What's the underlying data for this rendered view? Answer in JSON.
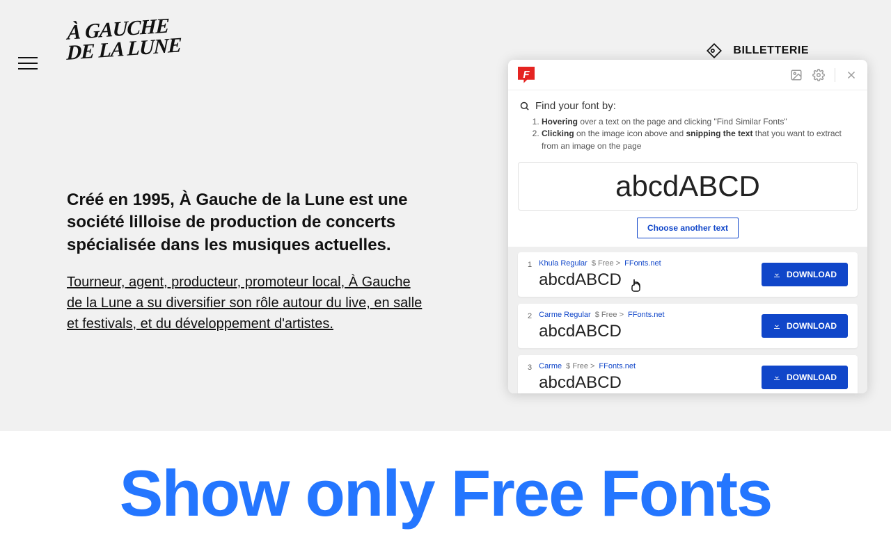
{
  "header": {
    "logo_line1": "À GAUCHE",
    "logo_line2": "DE LA LUNE",
    "billetterie": "BILLETTERIE"
  },
  "main": {
    "headline": "Créé en 1995, À Gauche de la Lune est une société lilloise de production de concerts spécialisée dans les musiques actuelles.",
    "sub": "Tourneur, agent, producteur, promoteur local, À Gauche de la Lune a su diversifier son rôle autour du live, en salle et festivals, et du développement d'artistes."
  },
  "panel": {
    "find_title": "Find your font by:",
    "inst1_pre": "Hovering",
    "inst1_post": " over a text on the page and clicking \"Find Similar Fonts\"",
    "inst2_pre": "Clicking",
    "inst2_mid": " on the image icon above and ",
    "inst2_bold": "snipping the text",
    "inst2_post": " that you want to extract from an image on the page",
    "sample": "abcdABCD",
    "choose": "Choose another text",
    "download_label": "DOWNLOAD",
    "results": [
      {
        "num": "1",
        "name": "Khula Regular",
        "price": "$ Free >",
        "source": "FFonts.net",
        "sample": "abcdABCD"
      },
      {
        "num": "2",
        "name": "Carme Regular",
        "price": "$ Free >",
        "source": "FFonts.net",
        "sample": "abcdABCD"
      },
      {
        "num": "3",
        "name": "Carme",
        "price": "$ Free >",
        "source": "FFonts.net",
        "sample": "abcdABCD"
      }
    ]
  },
  "banner": "Show only Free Fonts"
}
